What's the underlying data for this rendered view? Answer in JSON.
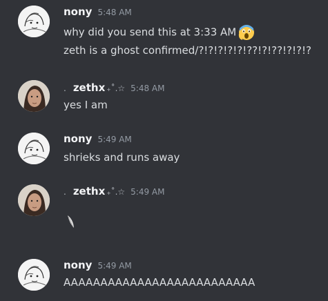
{
  "messages": [
    {
      "username": "nony",
      "timestamp": "5:48 AM",
      "lines": [
        "why did you send this at 3:33 AM",
        "zeth is a ghost confirmed/?!?!?!?!?!??!?!??!?!?!?"
      ],
      "emoji": "scream-emoji"
    },
    {
      "username_prefix": ".",
      "username": "zethx",
      "username_suffix": "₊˚.☆",
      "timestamp": "5:48 AM",
      "lines": [
        "yes I am"
      ]
    },
    {
      "username": "nony",
      "timestamp": "5:49 AM",
      "lines": [
        "shrieks and runs away"
      ]
    },
    {
      "username_prefix": ".",
      "username": "zethx",
      "username_suffix": "₊˚.☆",
      "timestamp": "5:49 AM",
      "lines": [],
      "attachment": "feather-icon"
    },
    {
      "username": "nony",
      "timestamp": "5:49 AM",
      "lines": [
        "AAAAAAAAAAAAAAAAAAAAAAAAAA"
      ]
    }
  ],
  "colors": {
    "background": "#313338",
    "username": "#f2f3f5",
    "timestamp": "#949ba4",
    "text": "#dbdee1"
  }
}
